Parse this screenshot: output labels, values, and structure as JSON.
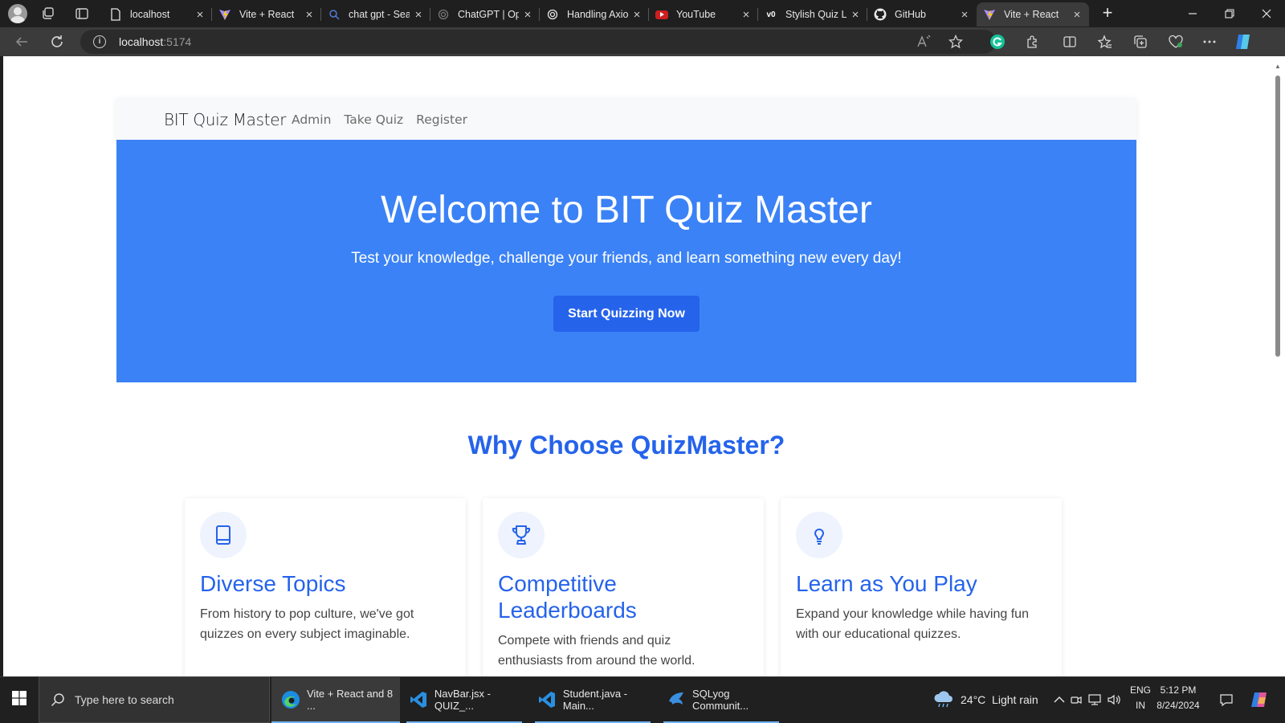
{
  "browser": {
    "tabs": [
      {
        "label": "localhost",
        "icon": "page-icon",
        "active": false
      },
      {
        "label": "Vite + React",
        "icon": "vite-icon",
        "active": false
      },
      {
        "label": "chat gpt - Sear",
        "icon": "search-icon",
        "active": false
      },
      {
        "label": "ChatGPT | Ope",
        "icon": "openai-icon",
        "active": false
      },
      {
        "label": "Handling Axio",
        "icon": "openai-icon",
        "active": false
      },
      {
        "label": "YouTube",
        "icon": "youtube-icon",
        "active": false
      },
      {
        "label": "Stylish Quiz La",
        "icon": "v0-icon",
        "active": false
      },
      {
        "label": "GitHub",
        "icon": "github-icon",
        "active": false
      },
      {
        "label": "Vite + React",
        "icon": "vite-icon",
        "active": true
      }
    ],
    "close_glyph": "×",
    "new_tab_glyph": "+",
    "address": {
      "host": "localhost",
      "port": ":5174"
    }
  },
  "site": {
    "brand": "BIT Quiz Master",
    "nav": [
      "Admin",
      "Take Quiz",
      "Register"
    ],
    "hero": {
      "title": "Welcome to BIT Quiz Master",
      "subtitle": "Test your knowledge, challenge your friends, and learn something new every day!",
      "cta": "Start Quizzing Now"
    },
    "why_title": "Why Choose QuizMaster?",
    "features": [
      {
        "icon": "book-icon",
        "title": "Diverse Topics",
        "text": "From history to pop culture, we've got quizzes on every subject imaginable."
      },
      {
        "icon": "trophy-icon",
        "title": "Competitive Leaderboards",
        "text": "Compete with friends and quiz enthusiasts from around the world."
      },
      {
        "icon": "lightbulb-icon",
        "title": "Learn as You Play",
        "text": "Expand your knowledge while having fun with our educational quizzes."
      }
    ]
  },
  "taskbar": {
    "search_placeholder": "Type here to search",
    "apps": [
      {
        "label": "Vite + React and 8 ...",
        "icon": "edge-icon",
        "active": true
      },
      {
        "label": "NavBar.jsx - QUIZ_...",
        "icon": "vscode-icon",
        "active": false
      },
      {
        "label": "Student.java - Main...",
        "icon": "vscode-icon",
        "active": false
      },
      {
        "label": "SQLyog Communit...",
        "icon": "sqlyog-icon",
        "active": false
      }
    ],
    "weather": "24°C  Light rain",
    "lang": {
      "line1": "ENG",
      "line2": "IN"
    },
    "clock": {
      "time": "5:12 PM",
      "date": "8/24/2024"
    }
  },
  "colors": {
    "hero_bg": "#3b82f6",
    "cta_bg": "#2563eb",
    "accent": "#2563eb",
    "taskbar_bg": "#202020"
  }
}
